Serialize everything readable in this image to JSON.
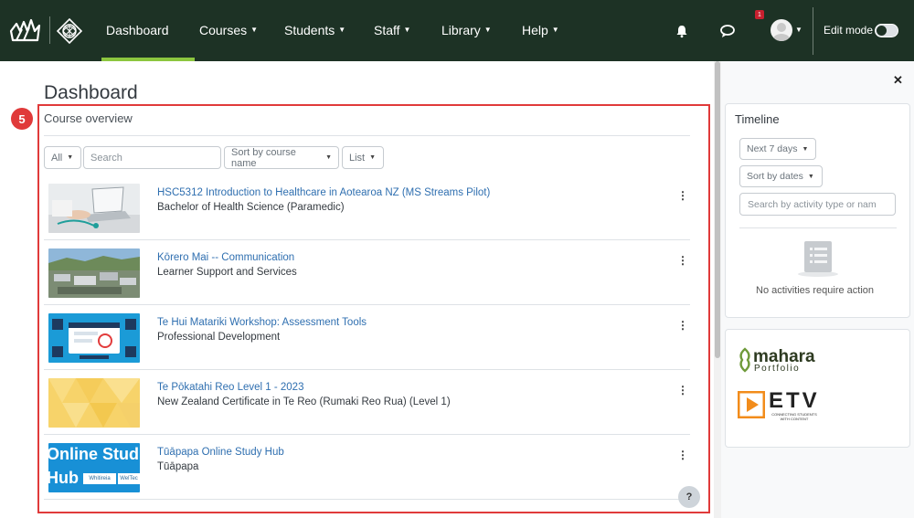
{
  "nav": {
    "items": [
      {
        "label": "Dashboard",
        "caret": ""
      },
      {
        "label": "Courses",
        "caret": "⌄"
      },
      {
        "label": "Students",
        "caret": "⌄"
      },
      {
        "label": "Staff",
        "caret": "⌄"
      },
      {
        "label": "Library",
        "caret": "⌄"
      },
      {
        "label": "Help",
        "caret": "⌄"
      }
    ],
    "notification_count": "1",
    "edit_mode_label": "Edit mode",
    "icons": [
      "brand-logo",
      "brand-emblem",
      "bell-icon",
      "chat-icon",
      "avatar",
      "chevron-down-icon"
    ]
  },
  "page": {
    "title": "Dashboard",
    "step_number": "5",
    "help_label": "?"
  },
  "course_overview": {
    "title": "Course overview",
    "filter_label": "All",
    "search_placeholder": "Search",
    "sort_label": "Sort by course name",
    "view_label": "List",
    "menu_glyph": "⋮",
    "courses": [
      {
        "name": "HSC5312 Introduction to Healthcare in Aotearoa NZ (MS Streams Pilot)",
        "category": "Bachelor of Health Science (Paramedic)",
        "thumb": "laptop-stethoscope-photo"
      },
      {
        "name": "Kōrero Mai -- Communication",
        "category": "Learner Support and Services",
        "thumb": "campus-aerial-photo"
      },
      {
        "name": "Te Hui Matariki Workshop: Assessment Tools",
        "category": "Professional Development",
        "thumb": "blue-web-tools-illustration"
      },
      {
        "name": "Te Pōkatahi Reo Level 1 - 2023",
        "category": "New Zealand Certificate in Te Reo (Rumaki Reo Rua) (Level 1)",
        "thumb": "yellow-geometric-pattern"
      },
      {
        "name": "Tūāpapa Online Study Hub",
        "category": "Tūāpapa",
        "thumb": "online-study-hub-banner"
      }
    ],
    "hub_thumb_text": {
      "line1": "Online Stud",
      "line2": "Hub",
      "chip1": "Whitireia",
      "chip2": "WelTec"
    }
  },
  "timeline": {
    "title": "Timeline",
    "range_label": "Next 7 days",
    "sort_label": "Sort by dates",
    "search_placeholder": "Search by activity type or nam",
    "empty_text": "No activities require action"
  },
  "links_block": {
    "mahara_name": "mahara",
    "mahara_sub": "Portfolio",
    "etv_name": "ETV",
    "etv_tagline": "CONNECTING STUDENTS WITH CONTENT"
  },
  "colors": {
    "navbar_bg": "#1d3225",
    "nav_active": "#8cc63f",
    "link": "#2f6fb0",
    "highlight": "#e03a3a"
  }
}
